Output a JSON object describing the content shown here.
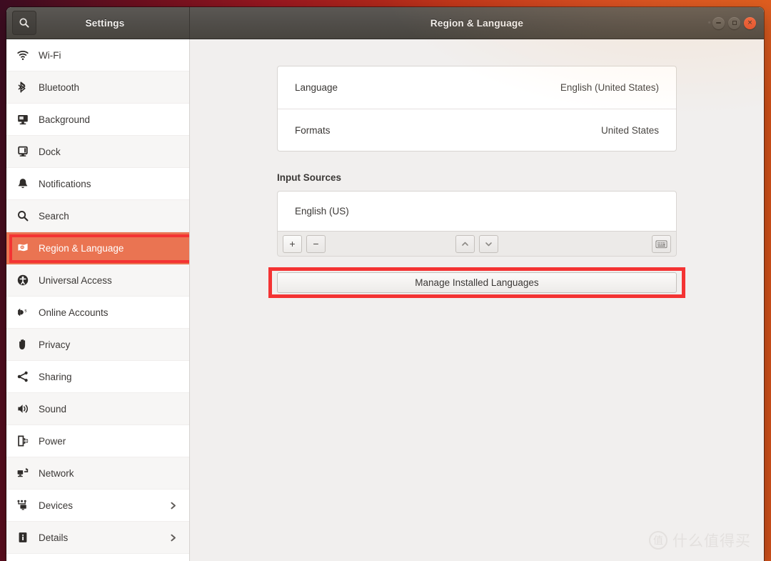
{
  "window": {
    "app_title": "Settings",
    "page_title": "Region & Language",
    "search_icon": "search-icon",
    "controls": {
      "minimize": "minimize-button",
      "maximize": "maximize-button",
      "close_glyph": "×"
    }
  },
  "sidebar": {
    "items": [
      {
        "label": "Wi-Fi",
        "icon": "wifi-icon",
        "selected": false,
        "chevron": false
      },
      {
        "label": "Bluetooth",
        "icon": "bluetooth-icon",
        "selected": false,
        "chevron": false
      },
      {
        "label": "Background",
        "icon": "background-monitor-icon",
        "selected": false,
        "chevron": false
      },
      {
        "label": "Dock",
        "icon": "dock-icon",
        "selected": false,
        "chevron": false
      },
      {
        "label": "Notifications",
        "icon": "bell-icon",
        "selected": false,
        "chevron": false
      },
      {
        "label": "Search",
        "icon": "search-icon",
        "selected": false,
        "chevron": false
      },
      {
        "label": "Region & Language",
        "icon": "flag-icon",
        "selected": true,
        "chevron": false
      },
      {
        "label": "Universal Access",
        "icon": "accessibility-icon",
        "selected": false,
        "chevron": false
      },
      {
        "label": "Online Accounts",
        "icon": "online-accounts-icon",
        "selected": false,
        "chevron": false
      },
      {
        "label": "Privacy",
        "icon": "hand-icon",
        "selected": false,
        "chevron": false
      },
      {
        "label": "Sharing",
        "icon": "share-nodes-icon",
        "selected": false,
        "chevron": false
      },
      {
        "label": "Sound",
        "icon": "speaker-icon",
        "selected": false,
        "chevron": false
      },
      {
        "label": "Power",
        "icon": "power-plug-icon",
        "selected": false,
        "chevron": false
      },
      {
        "label": "Network",
        "icon": "network-icon",
        "selected": false,
        "chevron": false
      },
      {
        "label": "Devices",
        "icon": "devices-icon",
        "selected": false,
        "chevron": true
      },
      {
        "label": "Details",
        "icon": "info-icon",
        "selected": false,
        "chevron": true
      }
    ]
  },
  "main": {
    "rows": [
      {
        "label": "Language",
        "value": "English (United States)"
      },
      {
        "label": "Formats",
        "value": "United States"
      }
    ],
    "input_sources": {
      "heading": "Input Sources",
      "items": [
        "English (US)"
      ],
      "toolbar": {
        "add_label": "+",
        "remove_label": "−",
        "move_up_label": "⌃",
        "move_down_label": "⌄",
        "keyboard_label": "keyboard-icon"
      }
    },
    "manage_button_label": "Manage Installed Languages"
  },
  "annotations": {
    "highlight_color": "#f43333",
    "boxes": [
      "sidebar-region-language-row",
      "manage-installed-languages-button"
    ]
  },
  "watermark": {
    "logo_glyph": "值",
    "text": "什么值得买"
  },
  "colors": {
    "selected_nav": "#ea7452",
    "titlebar": "#514e4a",
    "content_bg": "#f1efee",
    "close_button": "#e0502c"
  }
}
